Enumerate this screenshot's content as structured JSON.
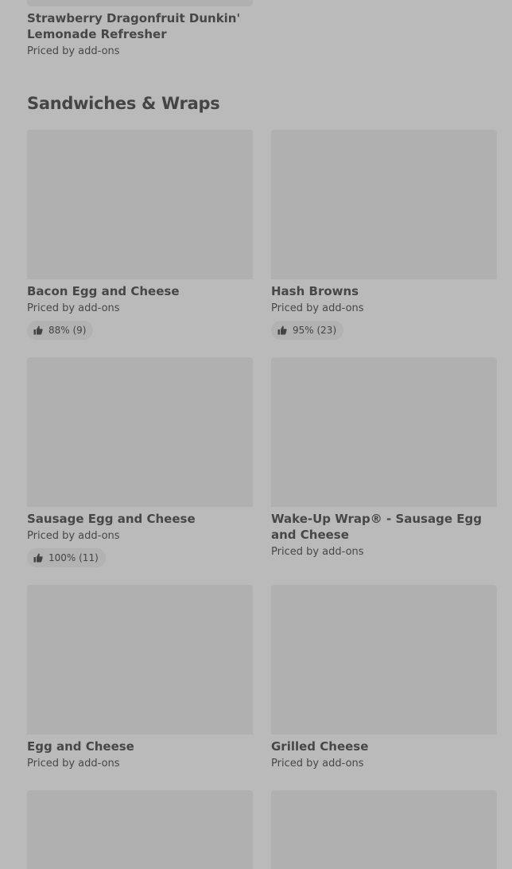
{
  "top_item": {
    "name": "Strawberry Dragonfruit Dunkin' Lemonade Refresher",
    "price": "Priced by add-ons"
  },
  "section": {
    "title": "Sandwiches & Wraps"
  },
  "items": [
    {
      "name": "Bacon Egg and Cheese",
      "price": "Priced by add-ons",
      "rating": "88% (9)"
    },
    {
      "name": "Hash Browns",
      "price": "Priced by add-ons",
      "rating": "95% (23)"
    },
    {
      "name": "Sausage Egg and Cheese",
      "price": "Priced by add-ons",
      "rating": "100% (11)"
    },
    {
      "name": "Wake-Up Wrap® - Sausage Egg and Cheese",
      "price": "Priced by add-ons"
    },
    {
      "name": "Egg and Cheese",
      "price": "Priced by add-ons"
    },
    {
      "name": "Grilled Cheese",
      "price": "Priced by add-ons"
    }
  ],
  "icons": {
    "rating": "thumbs-up-icon"
  },
  "colors": {
    "background": "#bababa",
    "image_placeholder": "#b0b0b0",
    "text": "#474747"
  }
}
